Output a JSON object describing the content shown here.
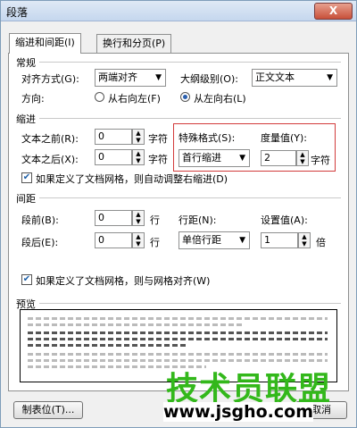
{
  "window": {
    "title": "段落",
    "close_label": "X"
  },
  "tabs": {
    "indent_spacing": "缩进和间距(I)",
    "line_page": "换行和分页(P)"
  },
  "general": {
    "header": "常规",
    "align_label": "对齐方式(G):",
    "align_value": "两端对齐",
    "outline_label": "大纲级别(O):",
    "outline_value": "正文文本",
    "direction_label": "方向:",
    "rtl_label": "从右向左(F)",
    "ltr_label": "从左向右(L)"
  },
  "indent": {
    "header": "缩进",
    "before_label": "文本之前(R):",
    "before_value": "0",
    "before_unit": "字符",
    "after_label": "文本之后(X):",
    "after_value": "0",
    "after_unit": "字符",
    "special_label": "特殊格式(S):",
    "special_value": "首行缩进",
    "measure_label": "度量值(Y):",
    "measure_value": "2",
    "measure_unit": "字符",
    "grid_check_label": "如果定义了文档网格，则自动调整右缩进(D)"
  },
  "spacing": {
    "header": "间距",
    "before_label": "段前(B):",
    "before_value": "0",
    "before_unit": "行",
    "after_label": "段后(E):",
    "after_value": "0",
    "after_unit": "行",
    "line_label": "行距(N):",
    "line_value": "单倍行距",
    "setting_label": "设置值(A):",
    "setting_value": "1",
    "setting_unit": "倍",
    "grid_check_label": "如果定义了文档网格，则与网格对齐(W)"
  },
  "preview": {
    "header": "预览"
  },
  "buttons": {
    "tabs": "制表位(T)...",
    "cancel": "取消"
  },
  "watermark": {
    "text": "技术员联盟",
    "url": "www.jsgho.com"
  },
  "colors": {
    "highlight": "#d23c3c",
    "watermark": "#33b81b"
  }
}
